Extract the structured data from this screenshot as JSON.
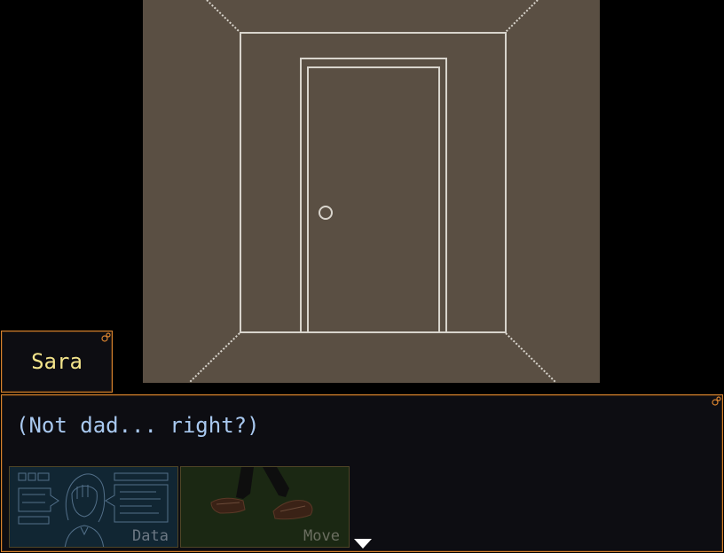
{
  "speaker": {
    "name": "Sara"
  },
  "dialogue": {
    "text": "(Not dad... right?)"
  },
  "menu": {
    "data_label": "Data",
    "move_label": "Move"
  },
  "colors": {
    "window_border": "#d8832f",
    "window_bg": "#0d0d12",
    "speaker_name": "#f3e48b",
    "dialogue_text": "#a9c9f0",
    "scene_bg": "#5a4f43",
    "scene_lines": "#d8d4cc"
  },
  "icons": {
    "data_button": "character-profile-icon",
    "move_button": "walking-feet-icon",
    "continue": "continue-arrow-icon"
  }
}
